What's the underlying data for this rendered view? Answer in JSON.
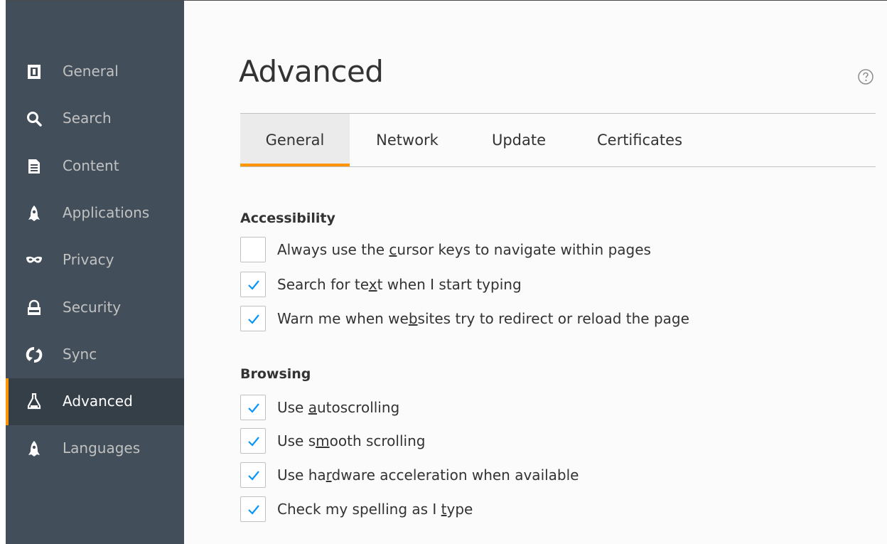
{
  "sidebar": {
    "items": [
      {
        "label": "General",
        "icon": "general-icon",
        "selected": false
      },
      {
        "label": "Search",
        "icon": "search-icon",
        "selected": false
      },
      {
        "label": "Content",
        "icon": "content-icon",
        "selected": false
      },
      {
        "label": "Applications",
        "icon": "applications-icon",
        "selected": false
      },
      {
        "label": "Privacy",
        "icon": "privacy-mask-icon",
        "selected": false
      },
      {
        "label": "Security",
        "icon": "security-icon",
        "selected": false
      },
      {
        "label": "Sync",
        "icon": "sync-icon",
        "selected": false
      },
      {
        "label": "Advanced",
        "icon": "advanced-icon",
        "selected": true
      },
      {
        "label": "Languages",
        "icon": "languages-icon",
        "selected": false
      }
    ]
  },
  "main": {
    "title": "Advanced",
    "help_icon": "help-icon",
    "tabs": [
      {
        "label": "General",
        "selected": true
      },
      {
        "label": "Network",
        "selected": false
      },
      {
        "label": "Update",
        "selected": false
      },
      {
        "label": "Certificates",
        "selected": false
      }
    ],
    "sections": [
      {
        "heading": "Accessibility",
        "options": [
          {
            "before": "Always use the ",
            "key": "c",
            "after": "ursor keys to navigate within pages",
            "checked": false
          },
          {
            "before": "Search for te",
            "key": "x",
            "after": "t when I start typing",
            "checked": true
          },
          {
            "before": "Warn me when we",
            "key": "b",
            "after": "sites try to redirect or reload the page",
            "checked": true
          }
        ]
      },
      {
        "heading": "Browsing",
        "options": [
          {
            "before": "Use ",
            "key": "a",
            "after": "utoscrolling",
            "checked": true
          },
          {
            "before": "Use s",
            "key": "m",
            "after": "ooth scrolling",
            "checked": true
          },
          {
            "before": "Use ha",
            "key": "r",
            "after": "dware acceleration when available",
            "checked": true
          },
          {
            "before": "Check my spelling as I ",
            "key": "t",
            "after": "ype",
            "checked": true
          }
        ]
      }
    ]
  },
  "colors": {
    "sidebar_bg": "#424f5a",
    "sidebar_selected_bg": "#343f48",
    "accent": "#ff9500",
    "check": "#0996f8"
  }
}
